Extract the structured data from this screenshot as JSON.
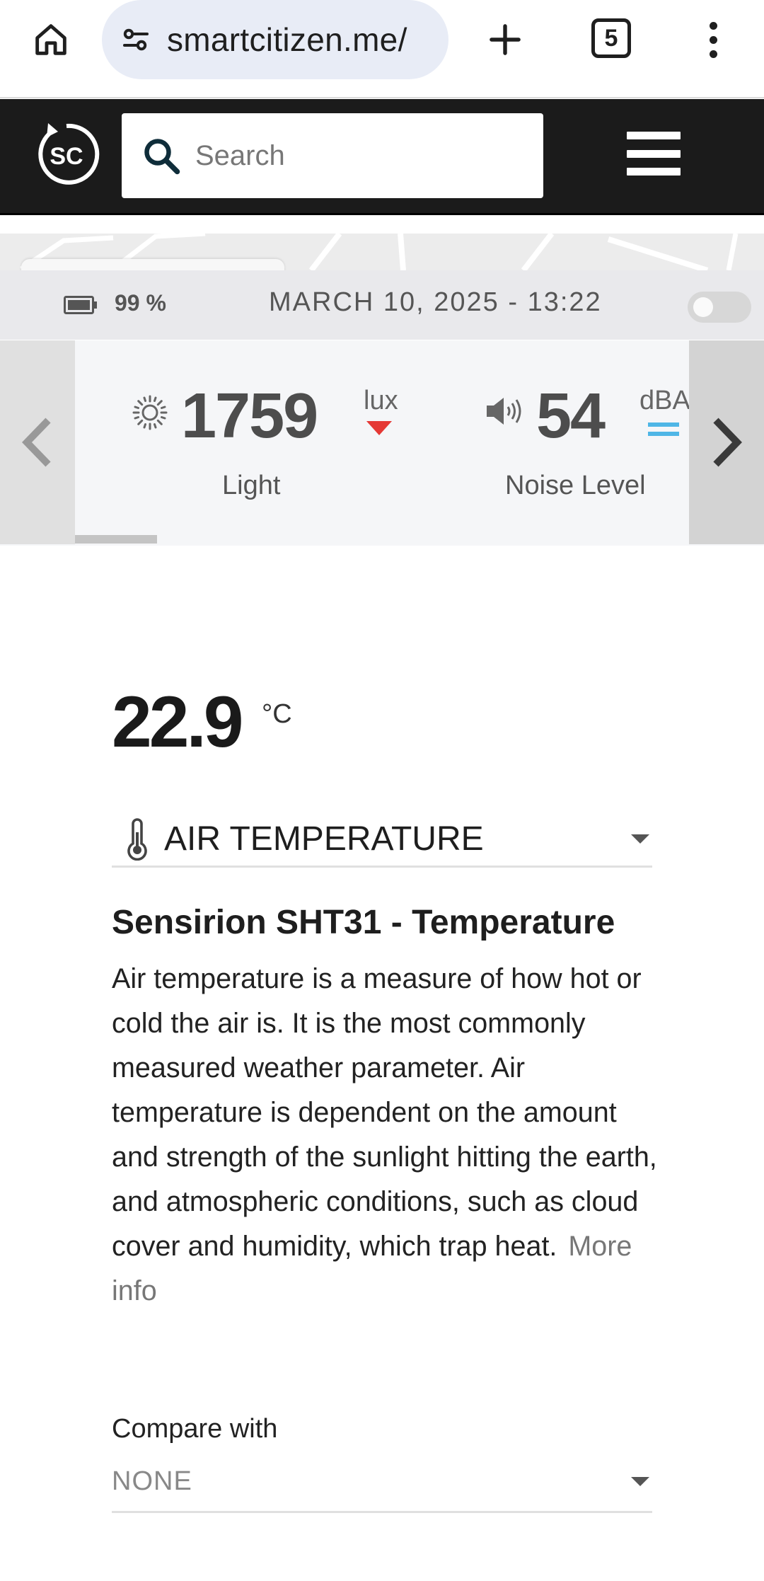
{
  "browser": {
    "url": "smartcitizen.me/",
    "tab_count": "5"
  },
  "header": {
    "logo_text": "SC",
    "search_placeholder": "Search"
  },
  "device_bar": {
    "battery": "99 %",
    "datetime": "MARCH 10, 2025 - 13:22",
    "toggle_on": false
  },
  "carousel": {
    "sensors": [
      {
        "value": "1759",
        "unit": "lux",
        "label": "Light",
        "icon": "sun-icon",
        "trend": "down",
        "trend_color": "#e53935"
      },
      {
        "value": "54",
        "unit": "dBA",
        "label": "Noise Level",
        "icon": "speaker-icon",
        "trend": "equal",
        "trend_color": "#4fb6e6"
      }
    ]
  },
  "main": {
    "value": "22.9",
    "unit": "°C",
    "selected_sensor": "AIR TEMPERATURE",
    "sensor_icon": "thermometer-icon",
    "sensor_title": "Sensirion SHT31 - Temperature",
    "description": "Air temperature is a measure of how hot or cold the air is. It is the most commonly measured weather parameter. Air temperature is dependent on the amount and strength of the sunlight hitting the earth, and atmospheric conditions, such as cloud cover and humidity, which trap heat.",
    "more_info": "More info",
    "compare_label": "Compare with",
    "compare_value": "NONE"
  }
}
